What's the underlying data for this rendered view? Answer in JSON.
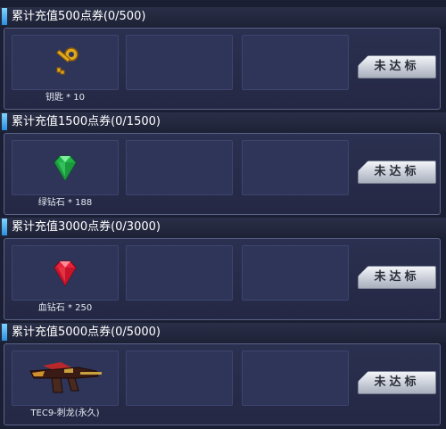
{
  "tiers": [
    {
      "title": "累计充值500点券(0/500)",
      "reward": {
        "label": "钥匙 * 10",
        "icon": "key-icon"
      },
      "button": "未达标"
    },
    {
      "title": "累计充值1500点券(0/1500)",
      "reward": {
        "label": "绿钻石 * 188",
        "icon": "green-diamond-icon"
      },
      "button": "未达标"
    },
    {
      "title": "累计充值3000点券(0/3000)",
      "reward": {
        "label": "血钻石 * 250",
        "icon": "red-diamond-icon"
      },
      "button": "未达标"
    },
    {
      "title": "累计充值5000点券(0/5000)",
      "reward": {
        "label": "TEC9-刺龙(永久)",
        "icon": "tec9-gun-icon"
      },
      "button": "未达标"
    }
  ],
  "colors": {
    "background": "#1b1f33",
    "header_accent": "#2a8ee0",
    "slot": "#2f3558",
    "button": "#c9ced8"
  }
}
